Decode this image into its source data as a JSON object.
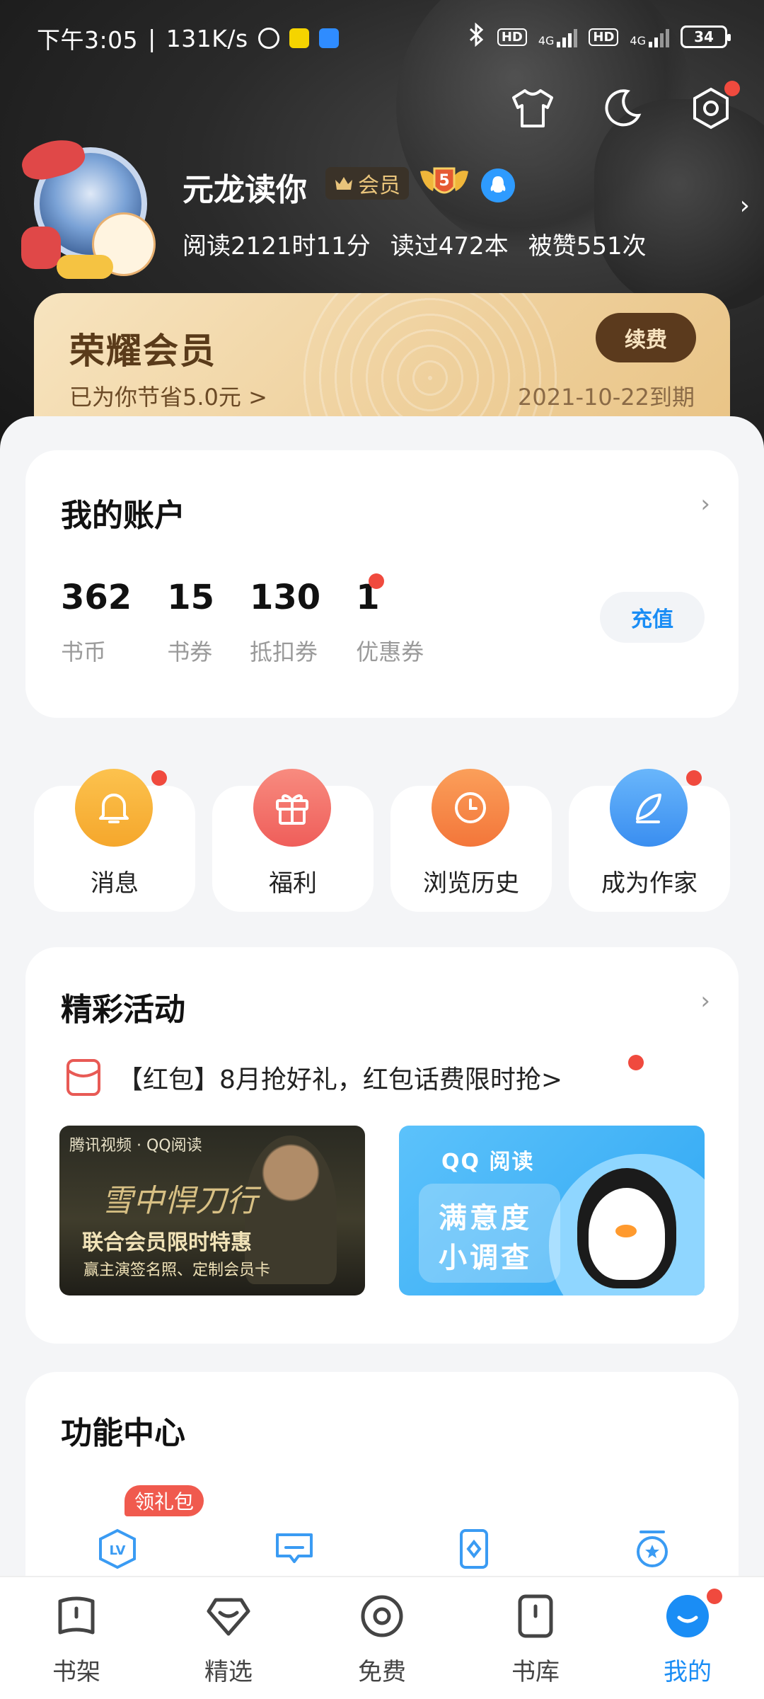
{
  "status_bar": {
    "time": "下午3:05",
    "speed": "131K/s",
    "hd1": "HD",
    "net1": "4G",
    "hd2": "HD",
    "net2": "4G",
    "battery": "34"
  },
  "profile": {
    "username": "元龙读你",
    "vip_label": "会员",
    "level": "5",
    "read_time": "阅读2121时11分",
    "books_read": "读过472本",
    "likes": "被赞551次"
  },
  "vip_card": {
    "title": "荣耀会员",
    "saved": "已为你节省5.0元 >",
    "renew": "续费",
    "expire": "2021-10-22到期"
  },
  "account": {
    "title": "我的账户",
    "items": [
      {
        "value": "362",
        "label": "书币"
      },
      {
        "value": "15",
        "label": "书券"
      },
      {
        "value": "130",
        "label": "抵扣券"
      },
      {
        "value": "1",
        "label": "优惠券"
      }
    ],
    "recharge": "充值"
  },
  "quick": [
    {
      "label": "消息",
      "icon": "bell-icon"
    },
    {
      "label": "福利",
      "icon": "gift-icon"
    },
    {
      "label": "浏览历史",
      "icon": "clock-icon"
    },
    {
      "label": "成为作家",
      "icon": "pen-icon"
    }
  ],
  "events": {
    "title": "精彩活动",
    "link": "【红包】8月抢好礼，红包话费限时抢>",
    "banner1": {
      "head": "腾讯视频 · QQ阅读",
      "calligraphy": "雪中悍刀行",
      "line1": "联合会员限时特惠",
      "line2": "赢主演签名照、定制会员卡"
    },
    "banner2": {
      "head": "QQ 阅读",
      "line1": "满意度",
      "line2": "小调查"
    }
  },
  "func": {
    "title": "功能中心",
    "gift_tag": "领礼包",
    "lv": "LV"
  },
  "nav": [
    {
      "label": "书架"
    },
    {
      "label": "精选"
    },
    {
      "label": "免费"
    },
    {
      "label": "书库"
    },
    {
      "label": "我的"
    }
  ],
  "colors": {
    "accent": "#1a8df5",
    "badge_red": "#f04a3e",
    "vip_gold": "#efd19e",
    "bell_orange": "#f8b23a",
    "gift_red": "#f26a63",
    "clock_orange": "#f78e4a",
    "pen_blue": "#4aa3f5"
  }
}
